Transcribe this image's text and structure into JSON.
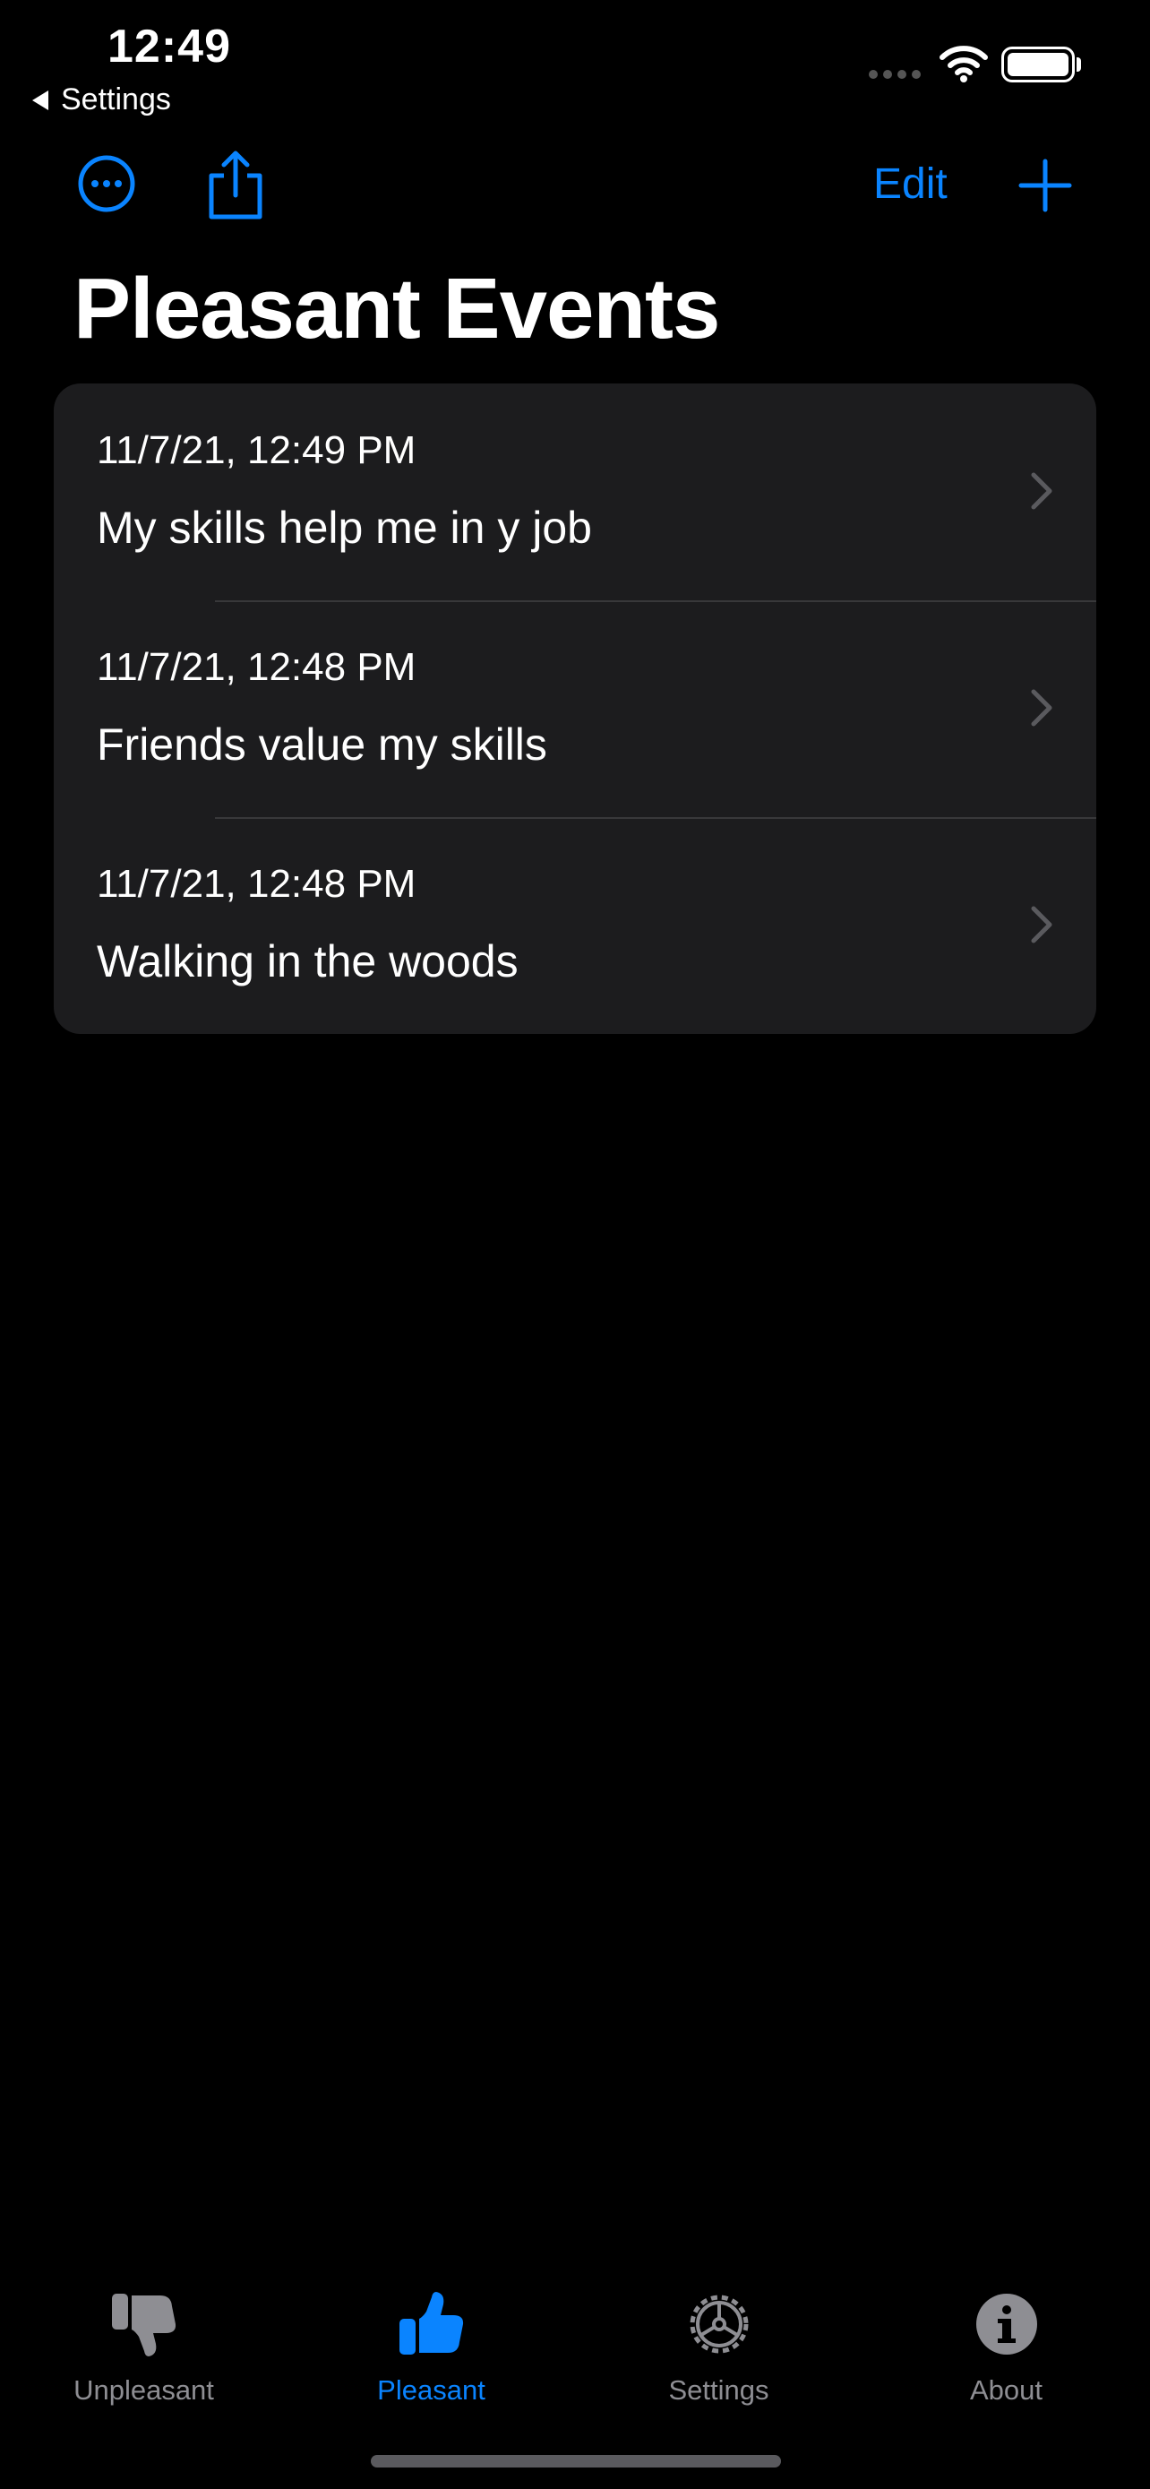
{
  "status_bar": {
    "time": "12:49",
    "back_label": "Settings"
  },
  "toolbar": {
    "more_icon": "ellipsis-circle-icon",
    "share_icon": "share-icon",
    "edit_label": "Edit",
    "add_icon": "plus-icon",
    "accent_color": "#0a84ff"
  },
  "page": {
    "title": "Pleasant Events"
  },
  "events": [
    {
      "date": "11/7/21, 12:49 PM",
      "title": "My skills help me in y job"
    },
    {
      "date": "11/7/21, 12:48 PM",
      "title": "Friends value my skills"
    },
    {
      "date": "11/7/21, 12:48 PM",
      "title": "Walking in the woods"
    }
  ],
  "tabbar": {
    "tabs": [
      {
        "label": "Unpleasant",
        "icon": "thumbs-down-icon",
        "selected": false
      },
      {
        "label": "Pleasant",
        "icon": "thumbs-up-icon",
        "selected": true
      },
      {
        "label": "Settings",
        "icon": "gear-icon",
        "selected": false
      },
      {
        "label": "About",
        "icon": "info-circle-icon",
        "selected": false
      }
    ]
  }
}
